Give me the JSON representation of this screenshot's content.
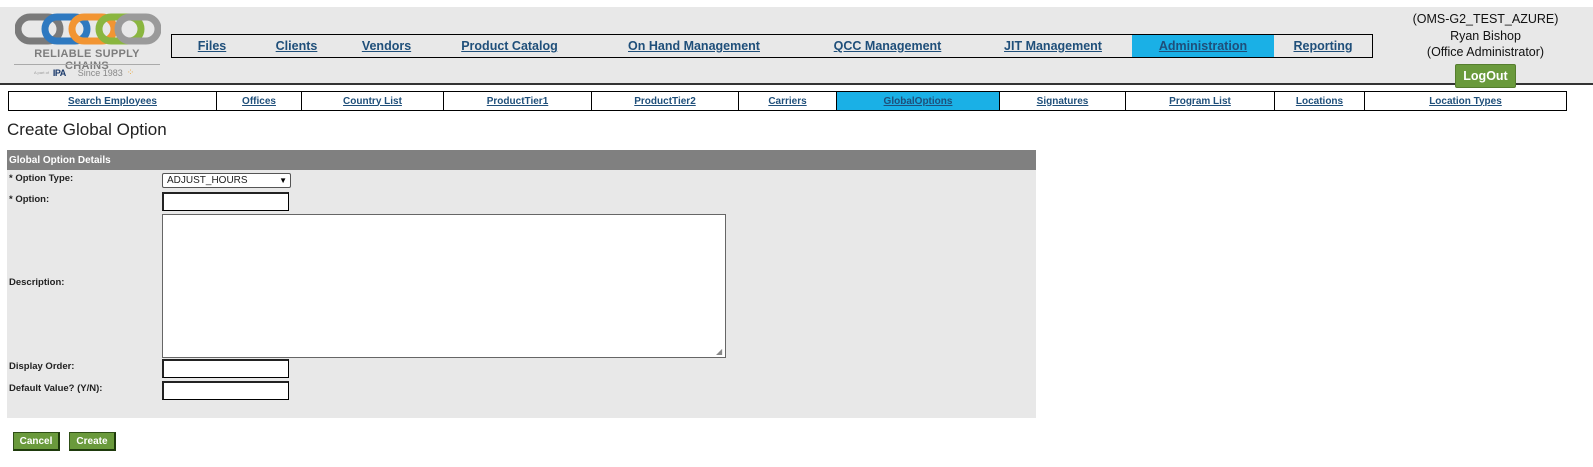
{
  "logo": {
    "name": "RELIABLE SUPPLY CHAINS",
    "tagline_prefix": "A part of",
    "partner": "IPA",
    "since": "Since 1983"
  },
  "main_nav": {
    "items": [
      {
        "label": "Files",
        "active": false
      },
      {
        "label": "Clients",
        "active": false
      },
      {
        "label": "Vendors",
        "active": false
      },
      {
        "label": "Product Catalog",
        "active": false
      },
      {
        "label": "On Hand Management",
        "active": false
      },
      {
        "label": "QCC Management",
        "active": false
      },
      {
        "label": "JIT Management",
        "active": false
      },
      {
        "label": "Administration",
        "active": true
      },
      {
        "label": "Reporting",
        "active": false
      }
    ]
  },
  "user": {
    "environment": "(OMS-G2_TEST_AZURE)",
    "name": "Ryan Bishop",
    "role": "(Office Administrator)",
    "logout_label": "LogOut"
  },
  "sub_nav": {
    "items": [
      {
        "label": "Search Employees",
        "active": false
      },
      {
        "label": "Offices",
        "active": false
      },
      {
        "label": "Country List",
        "active": false
      },
      {
        "label": "ProductTier1",
        "active": false
      },
      {
        "label": "ProductTier2",
        "active": false
      },
      {
        "label": "Carriers",
        "active": false
      },
      {
        "label": "GlobalOptions",
        "active": true
      },
      {
        "label": "Signatures",
        "active": false
      },
      {
        "label": "Program List",
        "active": false
      },
      {
        "label": "Locations",
        "active": false
      },
      {
        "label": "Location Types",
        "active": false
      }
    ]
  },
  "page": {
    "title": "Create Global Option"
  },
  "form": {
    "section_title": "Global Option Details",
    "option_type": {
      "label": "* Option Type:",
      "value": "ADJUST_HOURS"
    },
    "option": {
      "label": "* Option:",
      "value": ""
    },
    "description": {
      "label": "Description:",
      "value": ""
    },
    "display_order": {
      "label": "Display Order:",
      "value": ""
    },
    "default_value": {
      "label": "Default Value? (Y/N):",
      "value": ""
    }
  },
  "buttons": {
    "cancel": "Cancel",
    "create": "Create"
  },
  "colors": {
    "accent": "#1ab0e6",
    "button_green": "#6a9a3c",
    "panel_header": "#808080",
    "link": "#1f4f7a"
  }
}
